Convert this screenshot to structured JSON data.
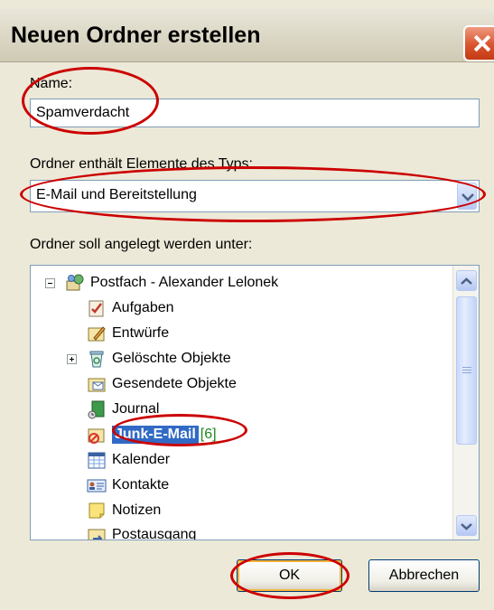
{
  "dialog": {
    "title": "Neuen Ordner erstellen"
  },
  "form": {
    "name_label": "Name:",
    "name_value": "Spamverdacht",
    "type_label": "Ordner enthält Elemente des Typs:",
    "type_value": "E-Mail und Bereitstellung",
    "location_label": "Ordner soll angelegt werden unter:"
  },
  "tree": {
    "root": {
      "label": "Postfach - Alexander Lelonek",
      "icon": "mailbox-icon",
      "expanded": true
    },
    "items": [
      {
        "label": "Aufgaben",
        "icon": "tasks-icon",
        "count": ""
      },
      {
        "label": "Entwürfe",
        "icon": "drafts-icon",
        "count": ""
      },
      {
        "label": "Gelöschte Objekte",
        "icon": "trash-icon",
        "count": "",
        "expandable": true
      },
      {
        "label": "Gesendete Objekte",
        "icon": "sent-icon",
        "count": ""
      },
      {
        "label": "Journal",
        "icon": "journal-icon",
        "count": ""
      },
      {
        "label": "Junk-E-Mail",
        "icon": "junk-icon",
        "count": "[6]",
        "selected": true
      },
      {
        "label": "Kalender",
        "icon": "calendar-icon",
        "count": ""
      },
      {
        "label": "Kontakte",
        "icon": "contacts-icon",
        "count": ""
      },
      {
        "label": "Notizen",
        "icon": "notes-icon",
        "count": ""
      },
      {
        "label": "Postausgang",
        "icon": "outbox-icon",
        "count": ""
      }
    ]
  },
  "buttons": {
    "ok": "OK",
    "cancel": "Abbrechen"
  },
  "annotation_color": "#cc0000",
  "selection_color": "#316ac5"
}
